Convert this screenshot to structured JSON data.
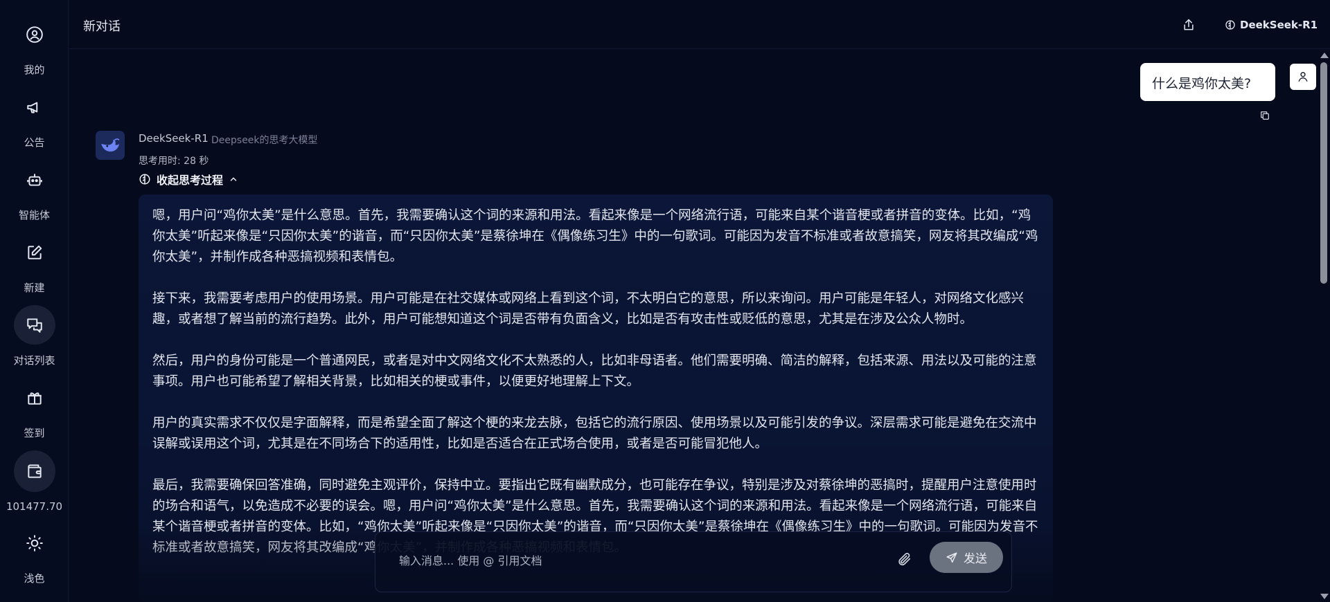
{
  "sidebar": {
    "items": [
      {
        "label": "我的",
        "icon": "user-circle-icon"
      },
      {
        "label": "公告",
        "icon": "megaphone-icon"
      },
      {
        "label": "智能体",
        "icon": "robot-icon"
      },
      {
        "label": "新建",
        "icon": "edit-icon"
      },
      {
        "label": "对话列表",
        "icon": "chat-list-icon",
        "active": true
      },
      {
        "label": "签到",
        "icon": "gift-icon"
      },
      {
        "label": "101477.70",
        "icon": "wallet-icon"
      },
      {
        "label": "浅色",
        "icon": "sun-icon"
      }
    ]
  },
  "header": {
    "title": "新对话",
    "model_name": "DeekSeek-R1"
  },
  "chat": {
    "user_message": "什么是鸡你太美?",
    "bot": {
      "name": "DeekSeek-R1",
      "description": "Deepseek的思考大模型",
      "think_time": "思考用时: 28 秒",
      "collapse_label": "收起思考过程",
      "paragraphs": [
        "嗯，用户问“鸡你太美”是什么意思。首先，我需要确认这个词的来源和用法。看起来像是一个网络流行语，可能来自某个谐音梗或者拼音的变体。比如，“鸡你太美”听起来像是“只因你太美”的谐音，而“只因你太美”是蔡徐坤在《偶像练习生》中的一句歌词。可能因为发音不标准或者故意搞笑，网友将其改编成“鸡你太美”，并制作成各种恶搞视频和表情包。",
        "接下来，我需要考虑用户的使用场景。用户可能是在社交媒体或网络上看到这个词，不太明白它的意思，所以来询问。用户可能是年轻人，对网络文化感兴趣，或者想了解当前的流行趋势。此外，用户可能想知道这个词是否带有负面含义，比如是否有攻击性或贬低的意思，尤其是在涉及公众人物时。",
        "然后，用户的身份可能是一个普通网民，或者是对中文网络文化不太熟悉的人，比如非母语者。他们需要明确、简洁的解释，包括来源、用法以及可能的注意事项。用户也可能希望了解相关背景，比如相关的梗或事件，以便更好地理解上下文。",
        "用户的真实需求不仅仅是字面解释，而是希望全面了解这个梗的来龙去脉，包括它的流行原因、使用场景以及可能引发的争议。深层需求可能是避免在交流中误解或误用这个词，尤其是在不同场合下的适用性，比如是否适合在正式场合使用，或者是否可能冒犯他人。",
        "最后，我需要确保回答准确，同时避免主观评价，保持中立。要指出它既有幽默成分，也可能存在争议，特别是涉及对蔡徐坤的恶搞时，提醒用户注意使用时的场合和语气，以免造成不必要的误会。嗯，用户问“鸡你太美”是什么意思。首先，我需要确认这个词的来源和用法。看起来像是一个网络流行语，可能来自某个谐音梗或者拼音的变体。比如，“鸡你太美”听起来像是“只因你太美”的谐音，而“只因你太美”是蔡徐坤在《偶像练习生》中的一句歌词。可能因为发音不标准或者故意搞笑，网友将其改编成“鸡你太美”，并制作成各种恶搞视频和表情包。"
      ]
    }
  },
  "composer": {
    "placeholder": "输入消息... 使用 @ 引用文档",
    "send_label": "发送"
  },
  "colors": {
    "background": "#050a1c",
    "think_box": "#0b1638",
    "send_button": "#6b7280"
  }
}
